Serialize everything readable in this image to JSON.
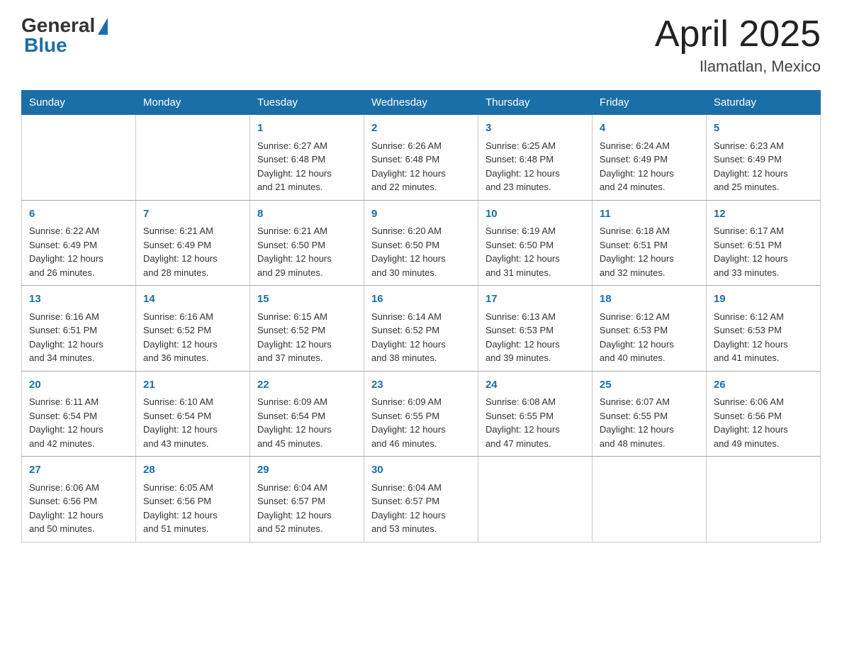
{
  "header": {
    "logo_general": "General",
    "logo_blue": "Blue",
    "title": "April 2025",
    "location": "Ilamatlan, Mexico"
  },
  "days_of_week": [
    "Sunday",
    "Monday",
    "Tuesday",
    "Wednesday",
    "Thursday",
    "Friday",
    "Saturday"
  ],
  "weeks": [
    [
      {
        "day": "",
        "info": ""
      },
      {
        "day": "",
        "info": ""
      },
      {
        "day": "1",
        "info": "Sunrise: 6:27 AM\nSunset: 6:48 PM\nDaylight: 12 hours\nand 21 minutes."
      },
      {
        "day": "2",
        "info": "Sunrise: 6:26 AM\nSunset: 6:48 PM\nDaylight: 12 hours\nand 22 minutes."
      },
      {
        "day": "3",
        "info": "Sunrise: 6:25 AM\nSunset: 6:48 PM\nDaylight: 12 hours\nand 23 minutes."
      },
      {
        "day": "4",
        "info": "Sunrise: 6:24 AM\nSunset: 6:49 PM\nDaylight: 12 hours\nand 24 minutes."
      },
      {
        "day": "5",
        "info": "Sunrise: 6:23 AM\nSunset: 6:49 PM\nDaylight: 12 hours\nand 25 minutes."
      }
    ],
    [
      {
        "day": "6",
        "info": "Sunrise: 6:22 AM\nSunset: 6:49 PM\nDaylight: 12 hours\nand 26 minutes."
      },
      {
        "day": "7",
        "info": "Sunrise: 6:21 AM\nSunset: 6:49 PM\nDaylight: 12 hours\nand 28 minutes."
      },
      {
        "day": "8",
        "info": "Sunrise: 6:21 AM\nSunset: 6:50 PM\nDaylight: 12 hours\nand 29 minutes."
      },
      {
        "day": "9",
        "info": "Sunrise: 6:20 AM\nSunset: 6:50 PM\nDaylight: 12 hours\nand 30 minutes."
      },
      {
        "day": "10",
        "info": "Sunrise: 6:19 AM\nSunset: 6:50 PM\nDaylight: 12 hours\nand 31 minutes."
      },
      {
        "day": "11",
        "info": "Sunrise: 6:18 AM\nSunset: 6:51 PM\nDaylight: 12 hours\nand 32 minutes."
      },
      {
        "day": "12",
        "info": "Sunrise: 6:17 AM\nSunset: 6:51 PM\nDaylight: 12 hours\nand 33 minutes."
      }
    ],
    [
      {
        "day": "13",
        "info": "Sunrise: 6:16 AM\nSunset: 6:51 PM\nDaylight: 12 hours\nand 34 minutes."
      },
      {
        "day": "14",
        "info": "Sunrise: 6:16 AM\nSunset: 6:52 PM\nDaylight: 12 hours\nand 36 minutes."
      },
      {
        "day": "15",
        "info": "Sunrise: 6:15 AM\nSunset: 6:52 PM\nDaylight: 12 hours\nand 37 minutes."
      },
      {
        "day": "16",
        "info": "Sunrise: 6:14 AM\nSunset: 6:52 PM\nDaylight: 12 hours\nand 38 minutes."
      },
      {
        "day": "17",
        "info": "Sunrise: 6:13 AM\nSunset: 6:53 PM\nDaylight: 12 hours\nand 39 minutes."
      },
      {
        "day": "18",
        "info": "Sunrise: 6:12 AM\nSunset: 6:53 PM\nDaylight: 12 hours\nand 40 minutes."
      },
      {
        "day": "19",
        "info": "Sunrise: 6:12 AM\nSunset: 6:53 PM\nDaylight: 12 hours\nand 41 minutes."
      }
    ],
    [
      {
        "day": "20",
        "info": "Sunrise: 6:11 AM\nSunset: 6:54 PM\nDaylight: 12 hours\nand 42 minutes."
      },
      {
        "day": "21",
        "info": "Sunrise: 6:10 AM\nSunset: 6:54 PM\nDaylight: 12 hours\nand 43 minutes."
      },
      {
        "day": "22",
        "info": "Sunrise: 6:09 AM\nSunset: 6:54 PM\nDaylight: 12 hours\nand 45 minutes."
      },
      {
        "day": "23",
        "info": "Sunrise: 6:09 AM\nSunset: 6:55 PM\nDaylight: 12 hours\nand 46 minutes."
      },
      {
        "day": "24",
        "info": "Sunrise: 6:08 AM\nSunset: 6:55 PM\nDaylight: 12 hours\nand 47 minutes."
      },
      {
        "day": "25",
        "info": "Sunrise: 6:07 AM\nSunset: 6:55 PM\nDaylight: 12 hours\nand 48 minutes."
      },
      {
        "day": "26",
        "info": "Sunrise: 6:06 AM\nSunset: 6:56 PM\nDaylight: 12 hours\nand 49 minutes."
      }
    ],
    [
      {
        "day": "27",
        "info": "Sunrise: 6:06 AM\nSunset: 6:56 PM\nDaylight: 12 hours\nand 50 minutes."
      },
      {
        "day": "28",
        "info": "Sunrise: 6:05 AM\nSunset: 6:56 PM\nDaylight: 12 hours\nand 51 minutes."
      },
      {
        "day": "29",
        "info": "Sunrise: 6:04 AM\nSunset: 6:57 PM\nDaylight: 12 hours\nand 52 minutes."
      },
      {
        "day": "30",
        "info": "Sunrise: 6:04 AM\nSunset: 6:57 PM\nDaylight: 12 hours\nand 53 minutes."
      },
      {
        "day": "",
        "info": ""
      },
      {
        "day": "",
        "info": ""
      },
      {
        "day": "",
        "info": ""
      }
    ]
  ]
}
